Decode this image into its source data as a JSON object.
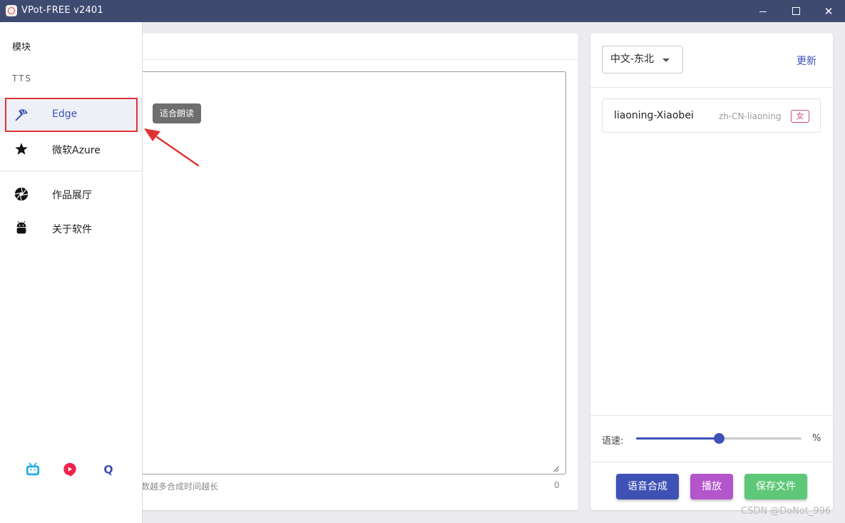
{
  "window": {
    "title": "VPot-FREE v2401",
    "controls": {
      "minimize": "minimize",
      "maximize": "maximize",
      "close": "✕"
    }
  },
  "drawer": {
    "heading": "模块",
    "subheading": "TTS",
    "items": [
      {
        "label": "Edge",
        "icon": "umbrella-icon",
        "active": true
      },
      {
        "label": "微软Azure",
        "icon": "star-icon",
        "active": false
      },
      {
        "label": "作品展厅",
        "icon": "aperture-icon",
        "active": false
      },
      {
        "label": "关于软件",
        "icon": "android-icon",
        "active": false
      }
    ],
    "social": [
      "bilibili-icon",
      "video-icon",
      "qq-icon"
    ]
  },
  "tooltip": {
    "text": "适合朗读"
  },
  "editor": {
    "value": "",
    "hint": "数越多合成时间越长",
    "char_count": "0"
  },
  "voice_panel": {
    "language_selected": "中文-东北",
    "refresh_label": "更新",
    "voices": [
      {
        "name": "liaoning-Xiaobei",
        "code": "zh-CN-liaoning",
        "gender": "女"
      }
    ],
    "speed_label": "语速:",
    "speed_unit": "%",
    "speed_fraction": 0.5
  },
  "actions": {
    "synthesize": "语音合成",
    "play": "播放",
    "save": "保存文件"
  },
  "watermark": "CSDN @DoNot_996",
  "colors": {
    "titlebar": "#3e4a70",
    "primary": "#3f51b5",
    "play": "#b455cc",
    "save": "#5fc878",
    "highlight": "#e03333"
  }
}
